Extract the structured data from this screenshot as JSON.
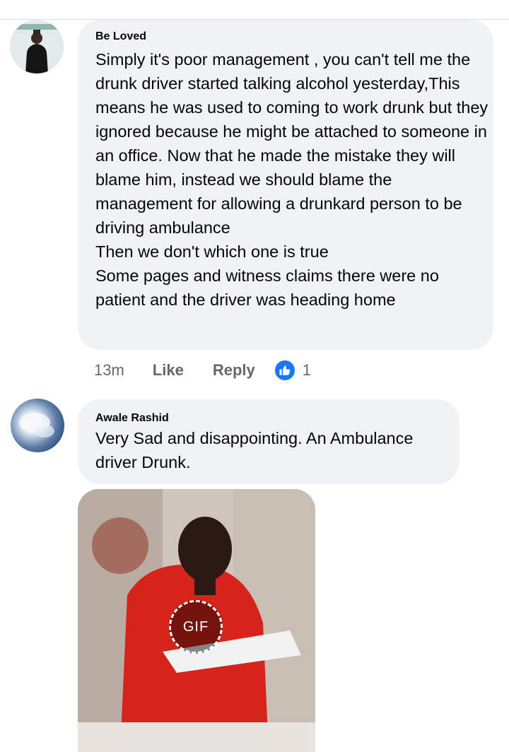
{
  "comments": [
    {
      "author": "Be Loved",
      "text": "Simply it's poor management , you can't tell me the drunk driver started talking alcohol yesterday,This means he was used to coming to work drunk but they ignored because he might be attached to someone in an office. Now that he made the mistake they will blame him, instead we should blame the management for allowing a drunkard person to be driving ambulance\nThen we don't which one is true\nSome pages and witness claims there were no patient and the driver was heading home",
      "time": "13m",
      "like_label": "Like",
      "reply_label": "Reply",
      "reaction_icon": "like-icon",
      "reaction_count": "1"
    },
    {
      "author": "Awale Rashid",
      "text": "Very Sad and disappointing. An Ambulance driver Drunk.",
      "gif_label": "GIF"
    }
  ],
  "colors": {
    "bubble": "#f0f2f5",
    "meta_text": "#65676b",
    "like_blue": "#1877f2"
  }
}
